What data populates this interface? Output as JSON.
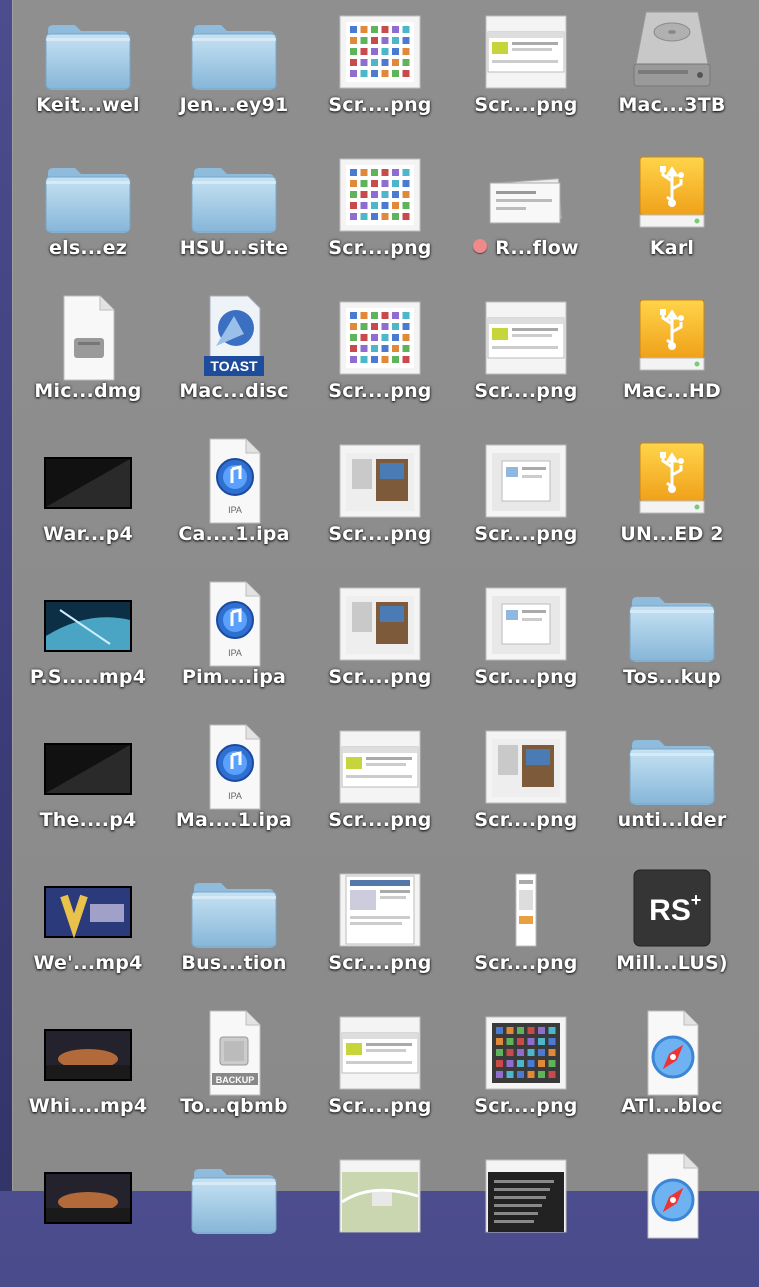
{
  "desktop": {
    "items": [
      {
        "label": "Keit...wel",
        "icon": "folder-icon"
      },
      {
        "label": "Jen...ey91",
        "icon": "folder-icon"
      },
      {
        "label": "Scr....png",
        "icon": "screenshot-grid-icon"
      },
      {
        "label": "Scr....png",
        "icon": "screenshot-web-icon"
      },
      {
        "label": "Mac...3TB",
        "icon": "hard-drive-icon"
      },
      {
        "label": "els...ez",
        "icon": "folder-icon"
      },
      {
        "label": "HSU...site",
        "icon": "folder-icon"
      },
      {
        "label": "Scr....png",
        "icon": "screenshot-grid-icon"
      },
      {
        "label": "R...flow",
        "icon": "document-stack-icon",
        "tag_color": "#f08a8a"
      },
      {
        "label": "Karl",
        "icon": "usb-drive-icon"
      },
      {
        "label": "Mic...dmg",
        "icon": "disk-image-icon"
      },
      {
        "label": "Mac...disc",
        "icon": "toast-disc-icon",
        "badge": "TOAST"
      },
      {
        "label": "Scr....png",
        "icon": "screenshot-grid-icon"
      },
      {
        "label": "Scr....png",
        "icon": "screenshot-web-icon"
      },
      {
        "label": "Mac...HD",
        "icon": "usb-drive-icon"
      },
      {
        "label": "War...p4",
        "icon": "video-dark-icon"
      },
      {
        "label": "Ca....1.ipa",
        "icon": "ipa-file-icon",
        "badge": "IPA"
      },
      {
        "label": "Scr....png",
        "icon": "screenshot-photo-icon"
      },
      {
        "label": "Scr....png",
        "icon": "screenshot-dialog-icon"
      },
      {
        "label": "UN...ED 2",
        "icon": "usb-drive-icon"
      },
      {
        "label": "P.S.....mp4",
        "icon": "video-blue-icon"
      },
      {
        "label": "Pim....ipa",
        "icon": "ipa-file-icon",
        "badge": "IPA"
      },
      {
        "label": "Scr....png",
        "icon": "screenshot-photo-icon"
      },
      {
        "label": "Scr....png",
        "icon": "screenshot-dialog-icon"
      },
      {
        "label": "Tos...kup",
        "icon": "folder-icon"
      },
      {
        "label": "The....p4",
        "icon": "video-dark-icon"
      },
      {
        "label": "Ma....1.ipa",
        "icon": "ipa-file-icon",
        "badge": "IPA"
      },
      {
        "label": "Scr....png",
        "icon": "screenshot-web-icon"
      },
      {
        "label": "Scr....png",
        "icon": "screenshot-photo-icon"
      },
      {
        "label": "unti...lder",
        "icon": "folder-icon"
      },
      {
        "label": "We'...mp4",
        "icon": "video-logo-icon"
      },
      {
        "label": "Bus...tion",
        "icon": "folder-icon"
      },
      {
        "label": "Scr....png",
        "icon": "screenshot-doc-icon"
      },
      {
        "label": "Scr....png",
        "icon": "screenshot-narrow-icon"
      },
      {
        "label": "Mill...LUS)",
        "icon": "app-rs-icon",
        "badge": "RS+"
      },
      {
        "label": "Whi....mp4",
        "icon": "video-sunset-icon"
      },
      {
        "label": "To...qbmb",
        "icon": "backup-file-icon",
        "badge": "BACKUP"
      },
      {
        "label": "Scr....png",
        "icon": "screenshot-web-icon"
      },
      {
        "label": "Scr....png",
        "icon": "screenshot-grid-dark-icon"
      },
      {
        "label": "ATI...bloc",
        "icon": "safari-webloc-icon"
      },
      {
        "label": "",
        "icon": "video-sunset-icon"
      },
      {
        "label": "",
        "icon": "folder-icon"
      },
      {
        "label": "",
        "icon": "screenshot-map-icon"
      },
      {
        "label": "",
        "icon": "screenshot-text-icon"
      },
      {
        "label": "",
        "icon": "safari-webloc-icon"
      }
    ]
  }
}
